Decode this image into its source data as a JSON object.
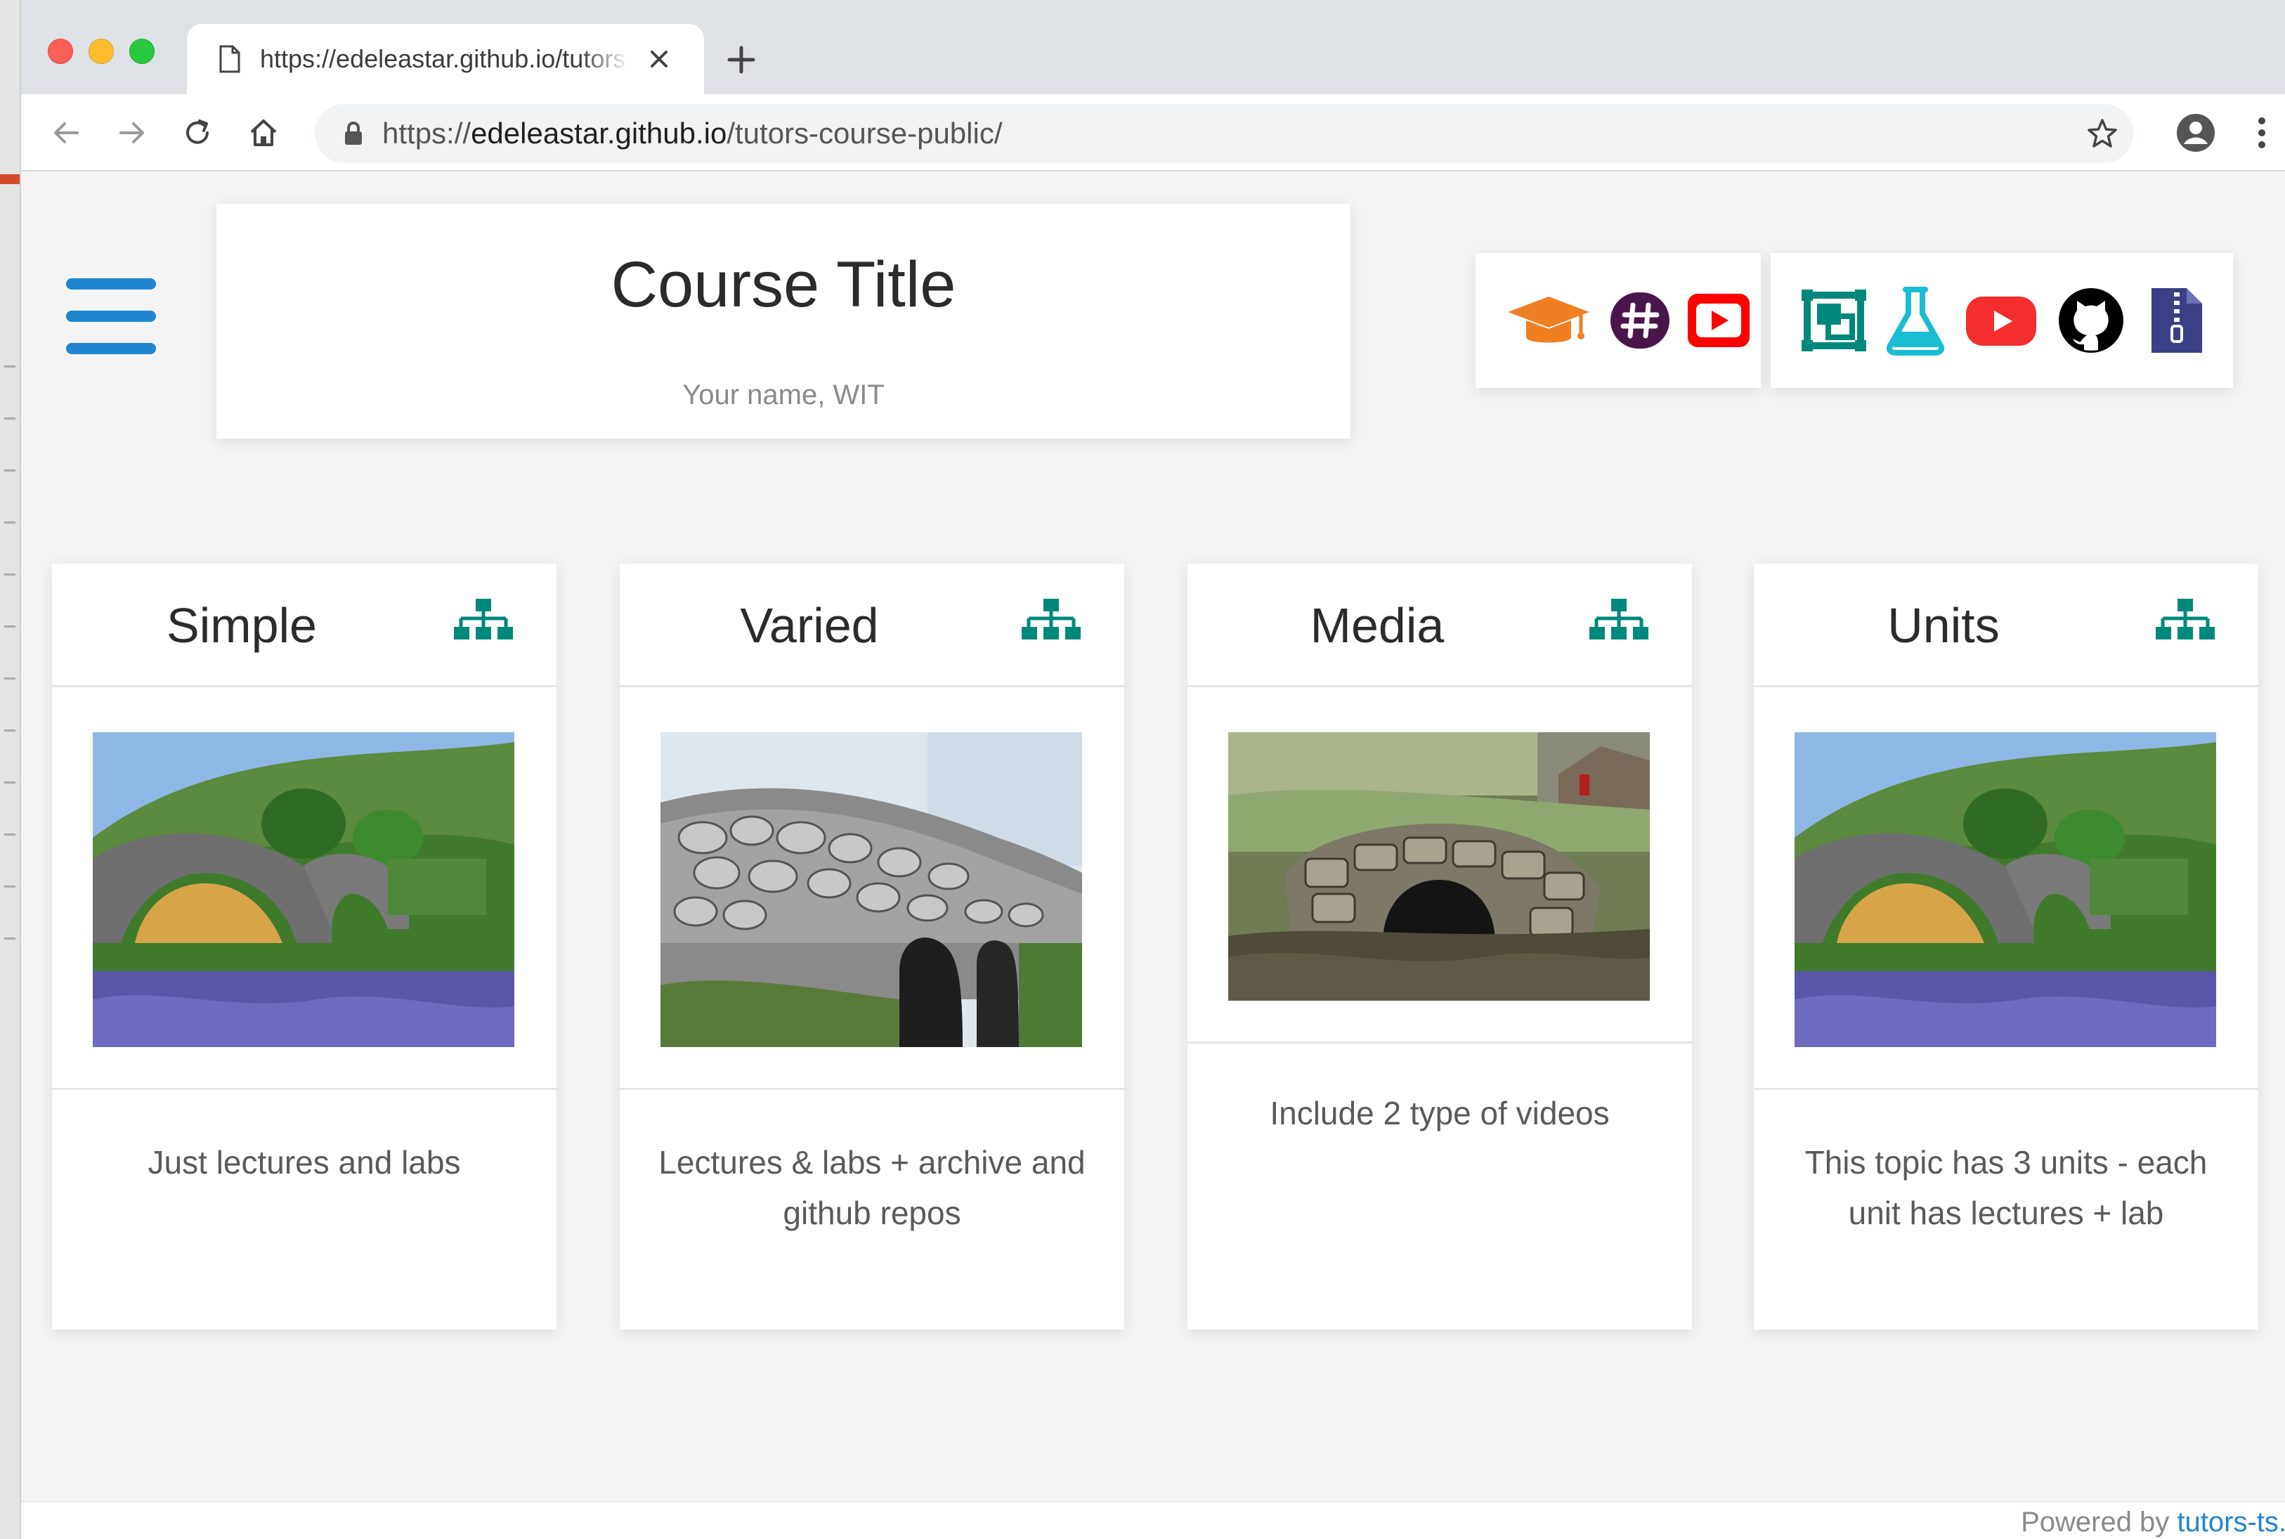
{
  "browser": {
    "tab_title": "https://edeleastar.github.io/tutors-course-public/",
    "url_prefix": "https://",
    "url_host": "edeleastar.github.io",
    "url_path": "/tutors-course-public/"
  },
  "course": {
    "title": "Course Title",
    "subtitle": "Your name, WIT"
  },
  "toolbar_icons": [
    "graduation-cap-icon",
    "slack-icon",
    "youtube-icon",
    "tutors-frame-icon",
    "lab-flask-icon",
    "youtube-icon",
    "github-icon",
    "archive-file-icon"
  ],
  "topics": [
    {
      "title": "Simple",
      "description": "Just lectures and labs",
      "image": "arched stone bridge over river"
    },
    {
      "title": "Varied",
      "description": "Lectures & labs + archive and github repos",
      "image": "rough stone bridge"
    },
    {
      "title": "Media",
      "description": "Include 2 type of videos",
      "image": "small mossy stone bridge"
    },
    {
      "title": "Units",
      "description": "This topic has 3 units - each unit has lectures + lab",
      "image": "arched stone bridge over river"
    }
  ],
  "footer": {
    "powered_prefix": "Powered by ",
    "powered_brand": "tutors-ts."
  },
  "colors": {
    "accent_blue": "#2185d0",
    "teal": "#00897b",
    "orange": "#f07f22",
    "youtube_red": "#ff0000",
    "slack_purple": "#4a154b"
  }
}
